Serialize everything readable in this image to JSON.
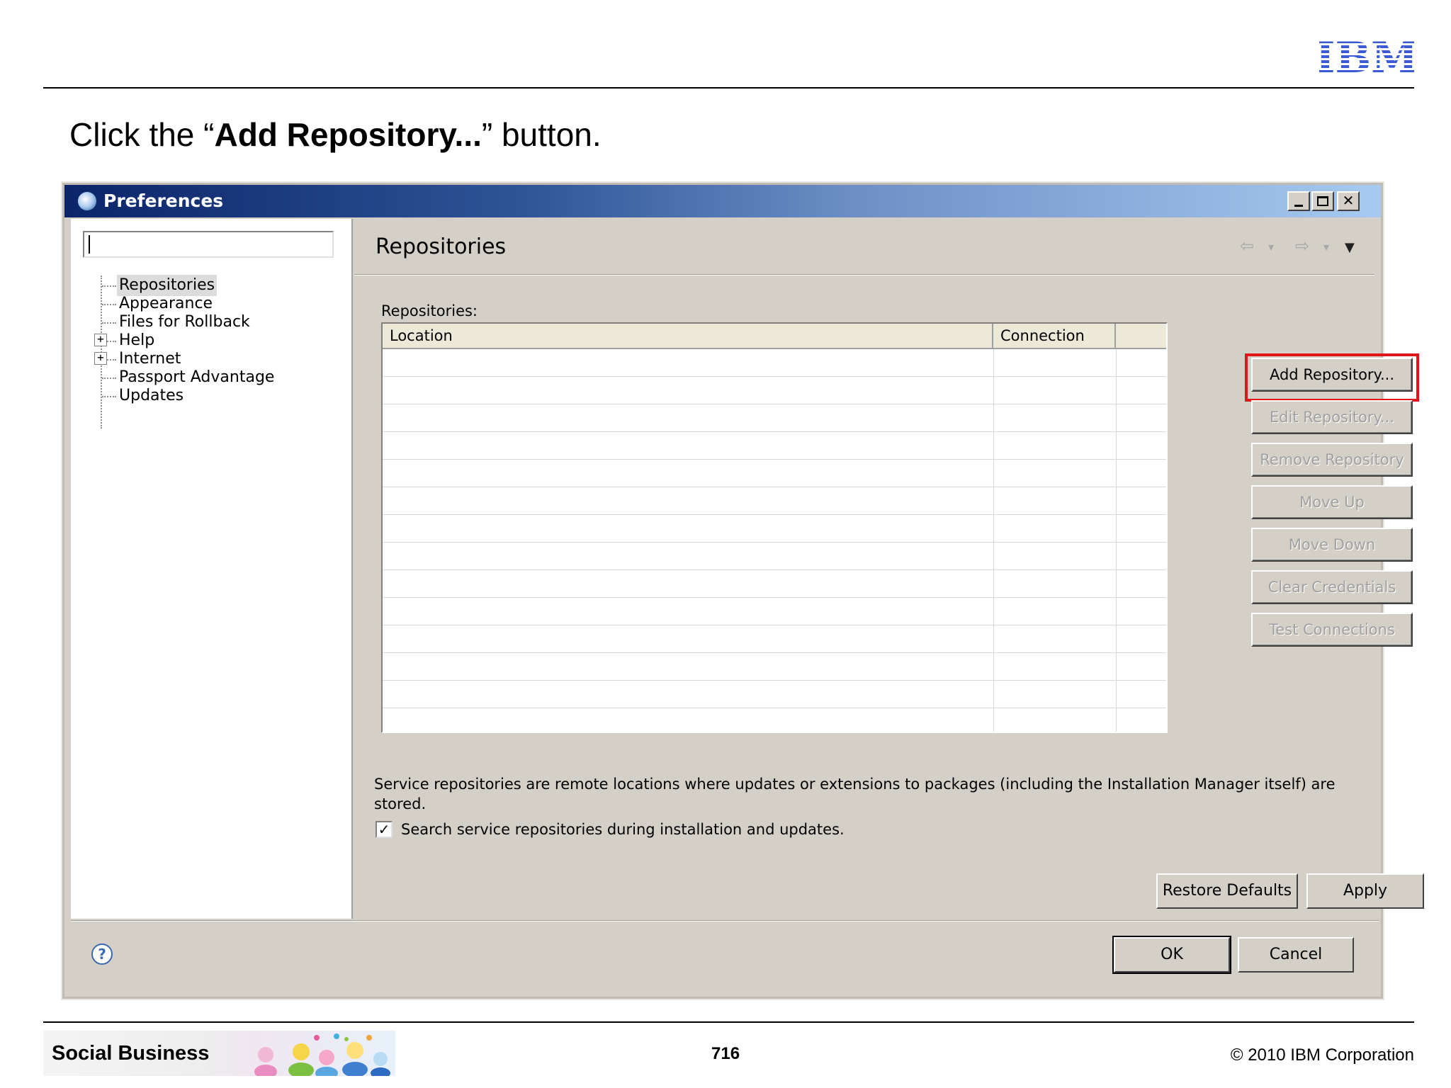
{
  "slide": {
    "logo_text": "IBM",
    "instruction_prefix": "Click the “",
    "instruction_bold": "Add Repository...",
    "instruction_suffix": "” button.",
    "footer_brand": "Social Business",
    "page_number": "716",
    "copyright": "© 2010 IBM Corporation"
  },
  "dialog": {
    "title": "Preferences",
    "window_controls": {
      "minimize": "minimize",
      "maximize": "maximize",
      "close": "✕"
    },
    "filter": {
      "value": "",
      "placeholder": ""
    },
    "tree": [
      {
        "label": "Repositories",
        "expandable": false,
        "selected": true
      },
      {
        "label": "Appearance",
        "expandable": false
      },
      {
        "label": "Files for Rollback",
        "expandable": false
      },
      {
        "label": "Help",
        "expandable": true
      },
      {
        "label": "Internet",
        "expandable": true
      },
      {
        "label": "Passport Advantage",
        "expandable": false
      },
      {
        "label": "Updates",
        "expandable": false
      }
    ],
    "expander_symbol": "+",
    "page_title": "Repositories",
    "nav": {
      "back": "⇦",
      "forward": "⇨",
      "dropdown": "▾",
      "menu": "▼"
    },
    "repositories_label": "Repositories:",
    "table": {
      "columns": [
        "Location",
        "Connection"
      ],
      "rows": []
    },
    "side_buttons": [
      {
        "label": "Add Repository...",
        "enabled": true,
        "highlighted": true
      },
      {
        "label": "Edit Repository...",
        "enabled": false
      },
      {
        "label": "Remove Repository",
        "enabled": false
      },
      {
        "label": "Move Up",
        "enabled": false
      },
      {
        "label": "Move Down",
        "enabled": false
      },
      {
        "label": "Clear Credentials",
        "enabled": false
      },
      {
        "label": "Test Connections",
        "enabled": false
      }
    ],
    "description": "Service repositories are remote locations where updates or extensions to packages (including the Installation Manager itself) are stored.",
    "search_checkbox": {
      "label": "Search service repositories during installation and updates.",
      "checked": true,
      "mark": "✓"
    },
    "restore_defaults": "Restore Defaults",
    "apply": "Apply",
    "help_symbol": "?",
    "ok": "OK",
    "cancel": "Cancel"
  },
  "colors": {
    "highlight": "#e0161b",
    "dialog_face": "#d4d0c8",
    "titlebar_start": "#0b246a",
    "titlebar_end": "#a6caf0",
    "ibm_blue": "#3b5bd6"
  }
}
